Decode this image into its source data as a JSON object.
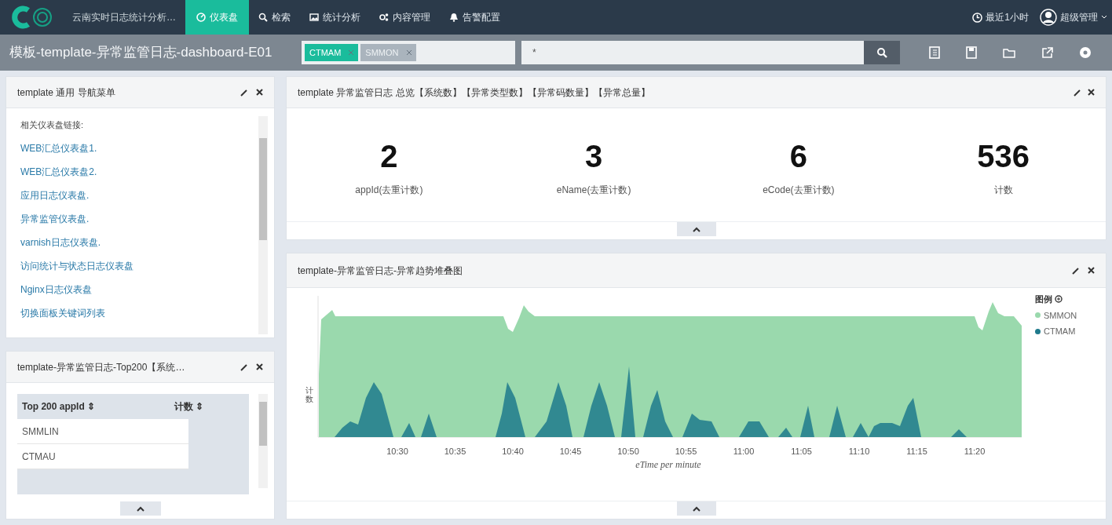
{
  "nav": {
    "app_title": "云南实时日志统计分析…",
    "items": [
      {
        "label": "仪表盘",
        "kind": "dashboard",
        "selected": true
      },
      {
        "label": "检索",
        "kind": "search",
        "selected": false
      },
      {
        "label": "统计分析",
        "kind": "chart",
        "selected": false
      },
      {
        "label": "内容管理",
        "kind": "content",
        "selected": false
      },
      {
        "label": "告警配置",
        "kind": "alert",
        "selected": false
      }
    ],
    "time_range": "最近1小时",
    "user": "超级管理"
  },
  "toolbar": {
    "title": "模板-template-异常监管日志-dashboard-E01",
    "filters": [
      {
        "label": "CTMAM",
        "selected": true
      },
      {
        "label": "SMMON",
        "selected": false
      }
    ],
    "query": "*"
  },
  "nav_panel": {
    "title": "template 通用 导航菜单",
    "heading": "相关仪表盘链接:",
    "links": [
      "WEB汇总仪表盘1.",
      "WEB汇总仪表盘2.",
      "应用日志仪表盘.",
      "异常监管仪表盘.",
      "varnish日志仪表盘.",
      "访问统计与状态日志仪表盘",
      "Nginx日志仪表盘",
      "切换面板关键词列表"
    ]
  },
  "top_panel": {
    "title": "template-异常监管日志-Top200【系统…",
    "columns": [
      "Top 200 appId ⇕",
      "计数 ⇕"
    ],
    "rows": [
      "SMMLIN",
      "CTMAU"
    ]
  },
  "overview_panel": {
    "title": "template 异常监管日志 总览【系统数】【异常类型数】【异常码数量】【异常总量】",
    "metrics": [
      {
        "value": "2",
        "label": "appId(去重计数)"
      },
      {
        "value": "3",
        "label": "eName(去重计数)"
      },
      {
        "value": "6",
        "label": "eCode(去重计数)"
      },
      {
        "value": "536",
        "label": "计数"
      }
    ]
  },
  "chart_panel": {
    "title": "template-异常监管日志-异常趋势堆叠图",
    "ylabel": "计数",
    "xlabel": "eTime per minute",
    "x_labels": [
      "10:30",
      "10:35",
      "10:40",
      "10:45",
      "10:50",
      "10:55",
      "11:00",
      "11:05",
      "11:10",
      "11:15",
      "11:20"
    ],
    "legend_title": "图例",
    "legend": [
      {
        "name": "SMMON",
        "color": "#9ad9ad"
      },
      {
        "name": "CTMAM",
        "color": "#1f7a8c"
      }
    ]
  }
}
